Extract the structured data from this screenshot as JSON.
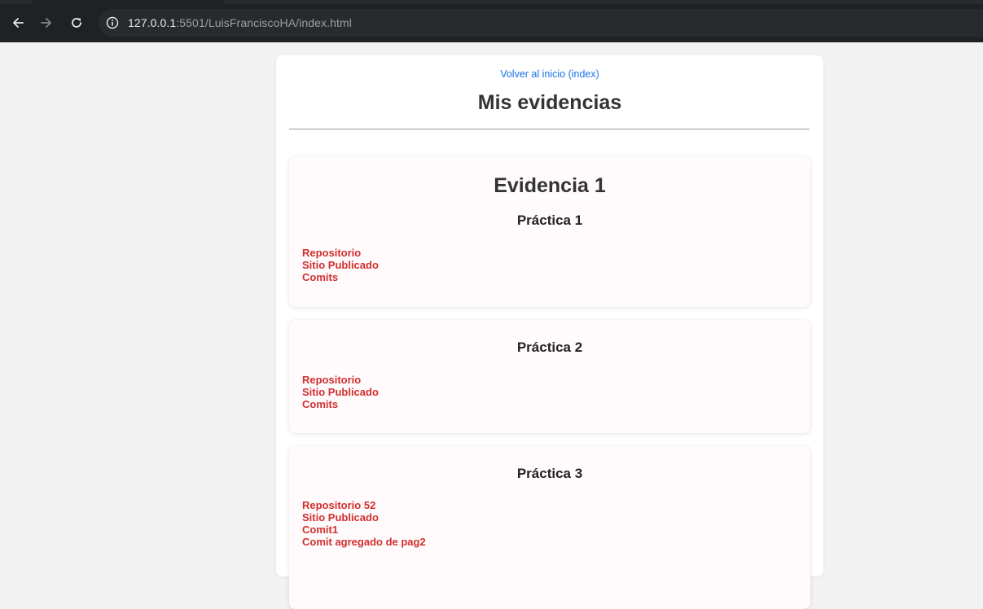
{
  "browser": {
    "url_host": "127.0.0.1",
    "url_rest": ":5501/LuisFranciscoHA/index.html"
  },
  "page": {
    "back_link": "Volver al inicio (index)",
    "title": "Mis evidencias"
  },
  "evidences": [
    {
      "title": "Evidencia 1",
      "practices": [
        {
          "title": "Práctica 1",
          "links": [
            "Repositorio",
            "Sitio Publicado",
            "Comits"
          ]
        },
        {
          "title": "Práctica 2",
          "links": [
            "Repositorio",
            "Sitio Publicado",
            "Comits"
          ]
        },
        {
          "title": "Práctica 3",
          "links": [
            "Repositorio 52",
            "Sitio Publicado",
            "Comit1",
            "Comit agregado de pag2"
          ]
        }
      ]
    }
  ],
  "colors": {
    "link_blue": "#1a73e8",
    "link_red": "#d32f2f",
    "chrome_bg": "#202124"
  },
  "icons": {
    "back": "arrow-left-icon",
    "forward": "arrow-right-icon",
    "reload": "reload-icon",
    "site_info": "info-icon"
  }
}
